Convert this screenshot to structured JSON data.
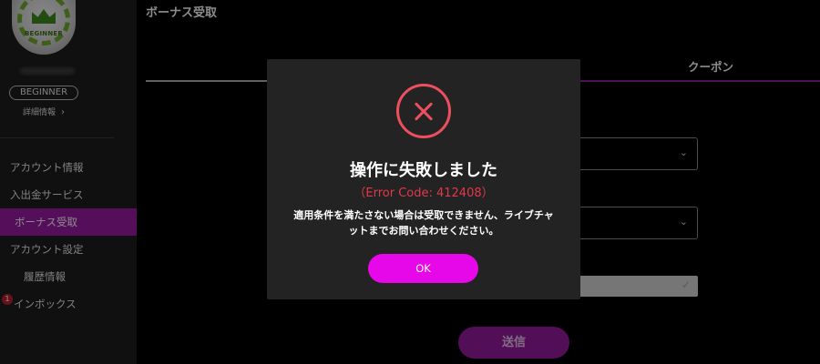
{
  "sidebar": {
    "logo_text": "BEGINNER",
    "rank": "BEGINNER",
    "detail_link": "詳細情報",
    "detail_chevron": "›",
    "notification_count": "1",
    "items": [
      {
        "label": "アカウント情報"
      },
      {
        "label": "入出金サービス"
      },
      {
        "label": "ボーナス受取",
        "active": true
      },
      {
        "label": "アカウント設定"
      },
      {
        "label": "履歴情報"
      },
      {
        "label": "インボックス"
      }
    ]
  },
  "main": {
    "page_title": "ボーナス受取",
    "tab_coupon": "クーポン",
    "caret": "⌄",
    "check": "✓",
    "submit_label": "送信"
  },
  "modal": {
    "icon": "error-x-circle-icon",
    "title": "操作に失敗しました",
    "error_code": "（Error Code: 412408）",
    "message_line1": "適用条件を満たさない場合は受取できません、ライブチャ",
    "message_line2": "ットまでお問い合わせください。",
    "ok_label": "OK"
  },
  "colors": {
    "accent": "#9a1aa5",
    "ok_button": "#e608e8",
    "error": "#ee4f5f"
  }
}
